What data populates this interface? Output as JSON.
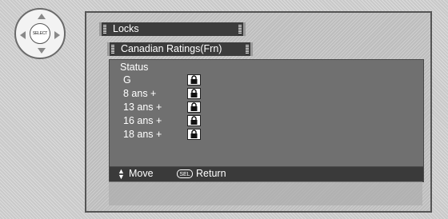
{
  "remote": {
    "center_button_label": "SELECT"
  },
  "menu": {
    "tab_locks": "Locks",
    "tab_ratings": "Canadian Ratings(Frn)"
  },
  "panel": {
    "status_label": "Status",
    "ratings": [
      {
        "label": "G",
        "lock_icon": "lock-icon"
      },
      {
        "label": "8 ans +",
        "lock_icon": "lock-icon"
      },
      {
        "label": "13 ans +",
        "lock_icon": "lock-icon"
      },
      {
        "label": "16 ans +",
        "lock_icon": "lock-icon"
      },
      {
        "label": "18 ans +",
        "lock_icon": "lock-icon"
      }
    ]
  },
  "footer": {
    "move_label": "Move",
    "sel_key_label": "SEL",
    "return_label": "Return"
  }
}
